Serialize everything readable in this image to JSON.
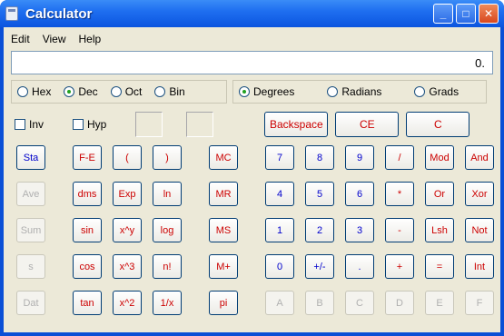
{
  "window": {
    "title": "Calculator"
  },
  "menu": [
    "Edit",
    "View",
    "Help"
  ],
  "display": {
    "value": "0."
  },
  "number_base": {
    "items": [
      "Hex",
      "Dec",
      "Oct",
      "Bin"
    ],
    "selected": "Dec"
  },
  "angle_units": {
    "items": [
      "Degrees",
      "Radians",
      "Grads"
    ],
    "selected": "Degrees"
  },
  "checkboxes": [
    "Inv",
    "Hyp"
  ],
  "top_buttons": [
    "Backspace",
    "CE",
    "C"
  ],
  "left_col": [
    "Sta",
    "Ave",
    "Sum",
    "s",
    "Dat"
  ],
  "sci": [
    [
      "F-E",
      "(",
      ")"
    ],
    [
      "dms",
      "Exp",
      "ln"
    ],
    [
      "sin",
      "x^y",
      "log"
    ],
    [
      "cos",
      "x^3",
      "n!"
    ],
    [
      "tan",
      "x^2",
      "1/x"
    ]
  ],
  "memory": [
    "MC",
    "MR",
    "MS",
    "M+",
    "pi"
  ],
  "digits": [
    [
      "7",
      "8",
      "9",
      "/",
      "Mod",
      "And"
    ],
    [
      "4",
      "5",
      "6",
      "*",
      "Or",
      "Xor"
    ],
    [
      "1",
      "2",
      "3",
      "-",
      "Lsh",
      "Not"
    ],
    [
      "0",
      "+/-",
      ".",
      "+",
      "=",
      "Int"
    ],
    [
      "A",
      "B",
      "C",
      "D",
      "E",
      "F"
    ]
  ]
}
